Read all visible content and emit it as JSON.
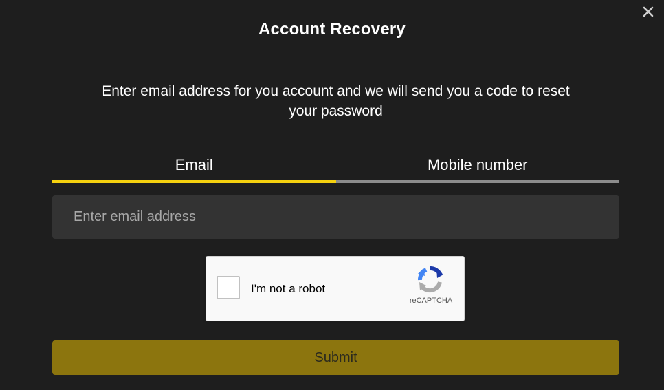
{
  "modal": {
    "title": "Account Recovery",
    "description": "Enter email address for you account and we will send you a code to reset your password",
    "close_icon": "close-icon"
  },
  "tabs": [
    {
      "label": "Email",
      "active": true
    },
    {
      "label": "Mobile number",
      "active": false
    }
  ],
  "email_field": {
    "value": "",
    "placeholder": "Enter email address"
  },
  "recaptcha": {
    "label": "I'm not a robot",
    "brand": "reCAPTCHA",
    "checked": false,
    "icon": "recaptcha-logo-icon"
  },
  "submit": {
    "label": "Submit"
  },
  "colors": {
    "background": "#1e1e1e",
    "accent": "#f5d10f",
    "inactive_tab": "#8c8c8c",
    "input_bg": "#333333",
    "submit_bg": "#8c750e"
  }
}
